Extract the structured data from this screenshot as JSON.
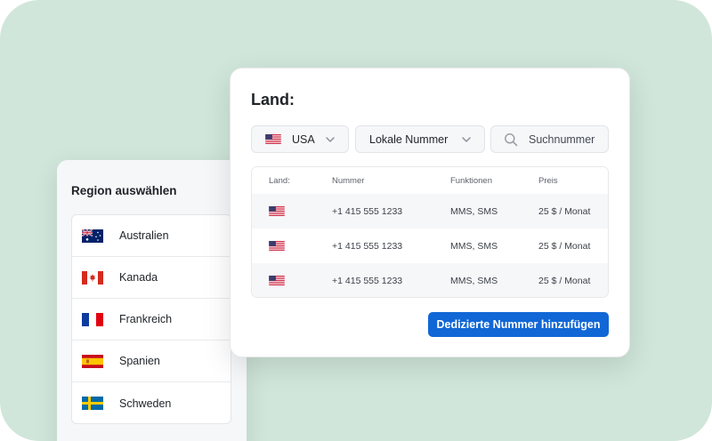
{
  "region_panel": {
    "title": "Region auswählen",
    "items": [
      {
        "label": "Australien",
        "flag": "australia-flag-icon"
      },
      {
        "label": "Kanada",
        "flag": "canada-flag-icon"
      },
      {
        "label": "Frankreich",
        "flag": "france-flag-icon"
      },
      {
        "label": "Spanien",
        "flag": "spain-flag-icon"
      },
      {
        "label": "Schweden",
        "flag": "sweden-flag-icon"
      }
    ]
  },
  "number_panel": {
    "title": "Land:",
    "country_select": {
      "value": "USA",
      "flag": "usa-flag-icon"
    },
    "type_select": {
      "value": "Lokale Nummer"
    },
    "search": {
      "placeholder": "Suchnummer"
    },
    "table": {
      "headers": [
        "Land:",
        "Nummer",
        "Funktionen",
        "Preis"
      ],
      "rows": [
        {
          "flag": "usa-flag-icon",
          "number": "+1 415 555 1233",
          "features": "MMS, SMS",
          "price": "25 $ / Monat"
        },
        {
          "flag": "usa-flag-icon",
          "number": "+1 415 555 1233",
          "features": "MMS, SMS",
          "price": "25 $ / Monat"
        },
        {
          "flag": "usa-flag-icon",
          "number": "+1 415 555 1233",
          "features": "MMS, SMS",
          "price": "25 $ / Monat"
        }
      ]
    },
    "add_button": "Dedizierte Nummer hinzufügen"
  },
  "colors": {
    "background": "#d0e6da",
    "accent": "#1167d6",
    "card": "#ffffff",
    "muted_surface": "#f6f7f9"
  }
}
